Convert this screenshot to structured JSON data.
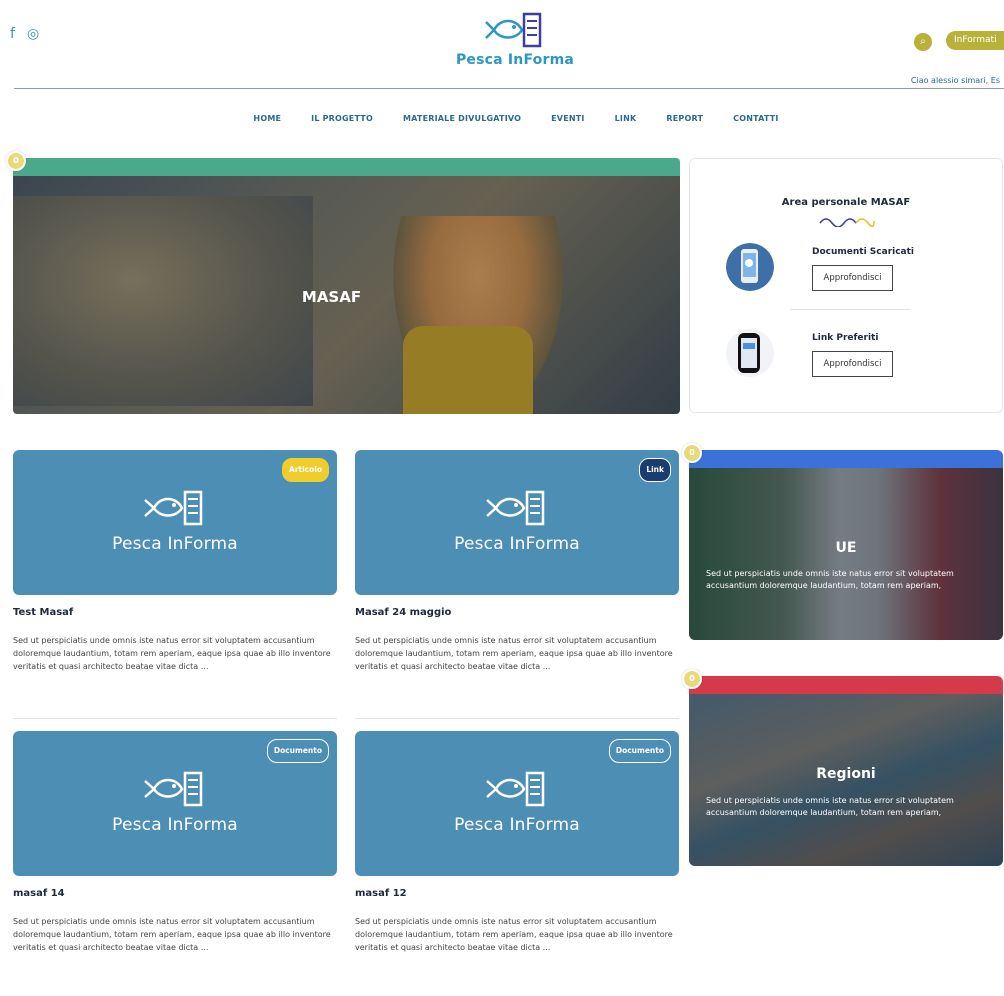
{
  "header": {
    "brand": "Pesca InForma",
    "info_button": "InFormati",
    "greeting": "Ciao alessio simari,  Es",
    "social": [
      {
        "icon": "facebook-icon",
        "glyph": "f"
      },
      {
        "icon": "instagram-icon",
        "glyph": "◎"
      }
    ]
  },
  "nav": [
    "HOME",
    "IL PROGETTO",
    "MATERIALE DIVULGATIVO",
    "EVENTI",
    "LINK",
    "REPORT",
    "CONTATTI"
  ],
  "hero": {
    "badge": "0",
    "title": "MASAF",
    "bar_color": "#4aa98b"
  },
  "personal_area": {
    "title": "Area personale MASAF",
    "items": [
      {
        "label": "Documenti Scaricati",
        "button": "Approfondisci"
      },
      {
        "label": "Link Preferiti",
        "button": "Approfondisci"
      }
    ]
  },
  "cards": [
    {
      "tag": "Articolo",
      "tag_type": "articolo",
      "logo_text": "Pesca InForma",
      "title": "Test Masaf",
      "desc": "Sed ut perspiciatis unde omnis iste natus error sit voluptatem accusantium doloremque laudantium, totam rem aperiam, eaque ipsa quae ab illo inventore veritatis et quasi architecto beatae vitae dicta ..."
    },
    {
      "tag": "Link",
      "tag_type": "link",
      "logo_text": "Pesca InForma",
      "title": "Masaf 24 maggio",
      "desc": "Sed ut perspiciatis unde omnis iste natus error sit voluptatem accusantium doloremque laudantium, totam rem aperiam, eaque ipsa quae ab illo inventore veritatis et quasi architecto beatae vitae dicta ..."
    },
    {
      "tag": "Documento",
      "tag_type": "documento",
      "logo_text": "Pesca InForma",
      "title": "masaf 14",
      "desc": "Sed ut perspiciatis unde omnis iste natus error sit voluptatem accusantium doloremque laudantium, totam rem aperiam, eaque ipsa quae ab illo inventore veritatis et quasi architecto beatae vitae dicta ..."
    },
    {
      "tag": "Documento",
      "tag_type": "documento",
      "logo_text": "Pesca InForma",
      "title": "masaf 12",
      "desc": "Sed ut perspiciatis unde omnis iste natus error sit voluptatem accusantium doloremque laudantium, totam rem aperiam, eaque ipsa quae ab illo inventore veritatis et quasi architecto beatae vitae dicta ..."
    }
  ],
  "side_panels": [
    {
      "badge": "0",
      "title": "UE",
      "bar_color": "#3b72d9",
      "text": "Sed ut perspiciatis unde omnis iste natus error sit voluptatem accusantium doloremque laudantium, totam rem aperiam,"
    },
    {
      "badge": "0",
      "title": "Regioni",
      "bar_color": "#d63a4a",
      "text": "Sed ut perspiciatis unde omnis iste natus error sit voluptatem accusantium doloremque laudantium, totam rem aperiam,"
    }
  ],
  "colors": {
    "brand": "#2c97c2",
    "card_bg": "#4d8fb4",
    "accent": "#b8b23a"
  }
}
